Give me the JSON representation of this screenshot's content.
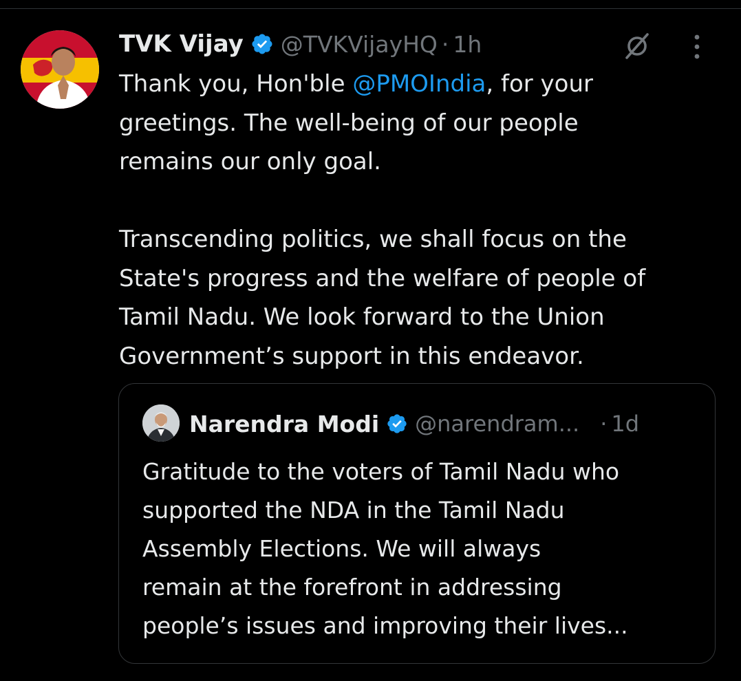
{
  "tweet": {
    "author": {
      "name": "TVK Vijay",
      "handle": "@TVKVijayHQ",
      "verified_color": "#1d9bf0"
    },
    "separator": "·",
    "time": "1h",
    "icons": {
      "verified": "verified-badge-icon",
      "grok": "grok-slash-icon",
      "more": "more-vertical-icon"
    },
    "body": {
      "line1_prefix": "Thank you, Hon'ble ",
      "line1_mention": "@PMOIndia",
      "line1_suffix": ", for your",
      "line2": "greetings. The well-being of our people",
      "line3": "remains our only goal.",
      "line4": "Transcending politics, we shall focus on the",
      "line5": "State's progress and the welfare of people of",
      "line6": "Tamil Nadu. We look forward to the Union",
      "line7": "Government’s support in this endeavor."
    }
  },
  "quote": {
    "author": {
      "name": "Narendra Modi",
      "handle": "@narendram...",
      "verified_color": "#1d9bf0"
    },
    "separator": "·",
    "time": "1d",
    "body": {
      "line1": "Gratitude to the voters of Tamil Nadu who",
      "line2": "supported the NDA in the Tamil Nadu",
      "line3": "Assembly Elections. We will always",
      "line4": "remain at the forefront in addressing",
      "line5": "people’s issues and improving their lives..."
    }
  },
  "colors": {
    "background": "#000000",
    "text": "#e7e9ea",
    "muted": "#71767b",
    "link": "#1d9bf0",
    "border": "#333639"
  }
}
